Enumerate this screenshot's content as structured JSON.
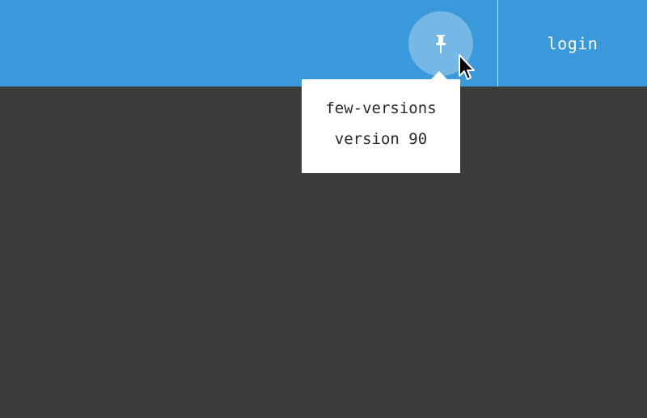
{
  "header": {
    "pin_icon": "pushpin-icon",
    "login_label": "login"
  },
  "tooltip": {
    "repo_name": "few-versions",
    "version_text": "version 90"
  },
  "colors": {
    "header_bg": "#3a99da",
    "page_bg": "#3c3c3c",
    "tooltip_bg": "#ffffff",
    "tooltip_text": "#2a2a2a"
  }
}
